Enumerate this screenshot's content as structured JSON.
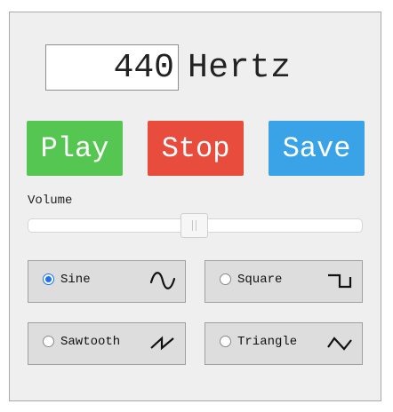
{
  "frequency": {
    "value": "440",
    "unit": "Hertz"
  },
  "buttons": {
    "play": "Play",
    "stop": "Stop",
    "save": "Save",
    "colors": {
      "play": "#56c652",
      "stop": "#e84c3d",
      "save": "#3aa3e8"
    }
  },
  "volume": {
    "label": "Volume",
    "level": 0.5
  },
  "waveforms": {
    "selected": "Sine",
    "options": [
      {
        "label": "Sine",
        "icon": "sine-wave-icon"
      },
      {
        "label": "Square",
        "icon": "square-wave-icon"
      },
      {
        "label": "Sawtooth",
        "icon": "sawtooth-wave-icon"
      },
      {
        "label": "Triangle",
        "icon": "triangle-wave-icon"
      }
    ]
  }
}
